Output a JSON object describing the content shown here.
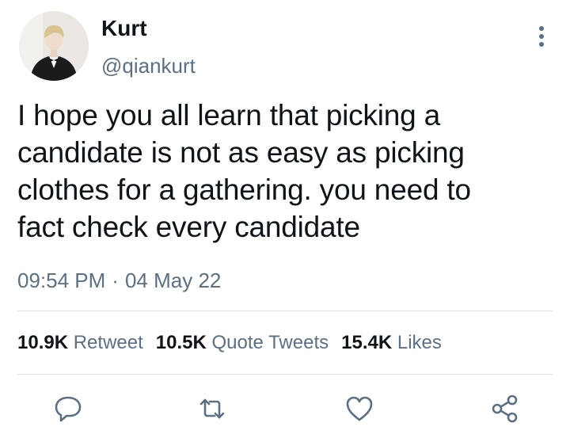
{
  "user": {
    "name": "Kurt",
    "handle": "@qiankurt"
  },
  "tweet": {
    "lines": [
      "I hope you all learn that picking a",
      "candidate is not as easy as picking",
      "clothes for a gathering. you need to",
      "fact check every candidate"
    ],
    "time": "09:54 PM",
    "separator": "·",
    "date": "04 May 22"
  },
  "stats": {
    "retweets": {
      "count": "10.9K",
      "label": "Retweet"
    },
    "quotes": {
      "count": "10.5K",
      "label": "Quote Tweets"
    },
    "likes": {
      "count": "15.4K",
      "label": "Likes"
    }
  },
  "icons": {
    "reply": "reply-icon",
    "retweet": "retweet-icon",
    "like": "heart-icon",
    "share": "share-icon",
    "more": "more-vertical-icon"
  },
  "colors": {
    "text": "#0f1419",
    "secondary": "#5b7083",
    "divider": "#dfe3e6"
  }
}
